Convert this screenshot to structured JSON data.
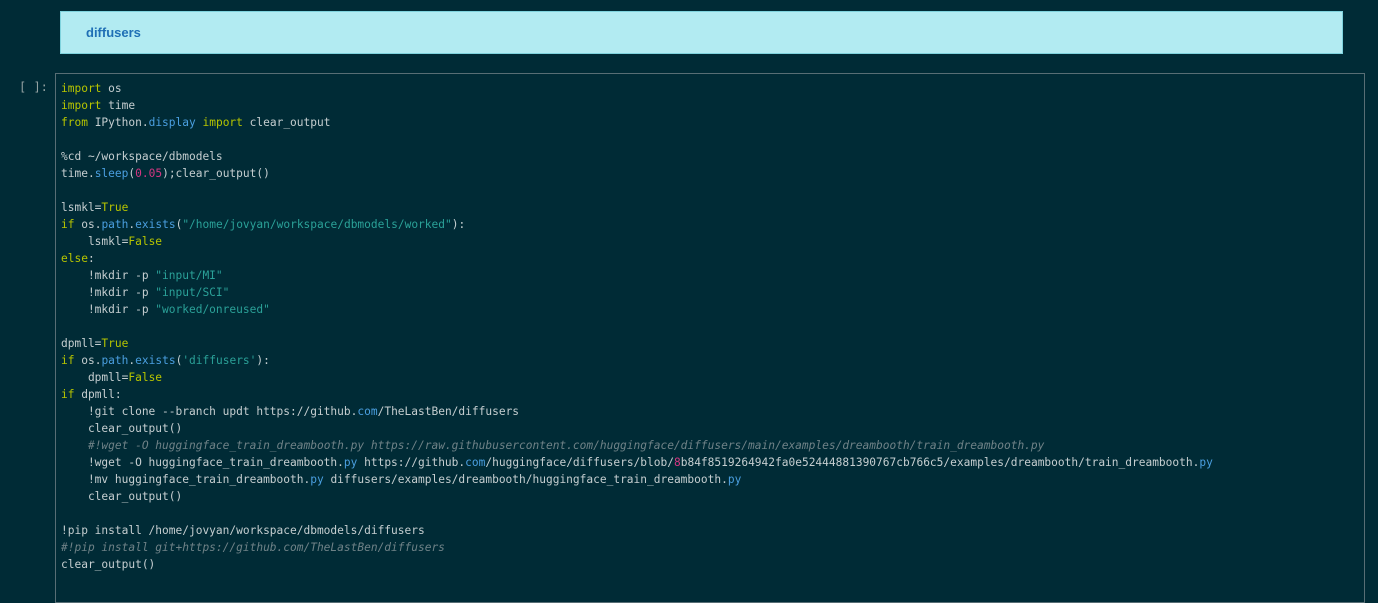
{
  "banner": {
    "title": "diffusers"
  },
  "cell": {
    "prompt": "[ ]:",
    "lines": [
      [
        [
          "kw",
          "import"
        ],
        [
          "plain",
          " os"
        ]
      ],
      [
        [
          "kw",
          "import"
        ],
        [
          "plain",
          " time"
        ]
      ],
      [
        [
          "kw",
          "from"
        ],
        [
          "plain",
          " IPython."
        ],
        [
          "attr",
          "display"
        ],
        [
          "plain",
          " "
        ],
        [
          "kw",
          "import"
        ],
        [
          "plain",
          " clear_output"
        ]
      ],
      [],
      [
        [
          "plain",
          "%cd ~/workspace/dbmodels"
        ]
      ],
      [
        [
          "plain",
          "time."
        ],
        [
          "attr",
          "sleep"
        ],
        [
          "plain",
          "("
        ],
        [
          "num",
          "0.05"
        ],
        [
          "plain",
          ");clear_output()"
        ]
      ],
      [],
      [
        [
          "plain",
          "lsmkl="
        ],
        [
          "kw",
          "True"
        ]
      ],
      [
        [
          "kw",
          "if"
        ],
        [
          "plain",
          " os."
        ],
        [
          "attr",
          "path"
        ],
        [
          "plain",
          "."
        ],
        [
          "attr",
          "exists"
        ],
        [
          "plain",
          "("
        ],
        [
          "str",
          "\"/home/jovyan/workspace/dbmodels/worked\""
        ],
        [
          "plain",
          "):"
        ]
      ],
      [
        [
          "plain",
          "    lsmkl="
        ],
        [
          "kw",
          "False"
        ]
      ],
      [
        [
          "kw",
          "else"
        ],
        [
          "plain",
          ":"
        ]
      ],
      [
        [
          "plain",
          "    !mkdir -p "
        ],
        [
          "str",
          "\"input/MI\""
        ]
      ],
      [
        [
          "plain",
          "    !mkdir -p "
        ],
        [
          "str",
          "\"input/SCI\""
        ]
      ],
      [
        [
          "plain",
          "    !mkdir -p "
        ],
        [
          "str",
          "\"worked/onreused\""
        ]
      ],
      [],
      [
        [
          "plain",
          "dpmll="
        ],
        [
          "kw",
          "True"
        ]
      ],
      [
        [
          "kw",
          "if"
        ],
        [
          "plain",
          " os."
        ],
        [
          "attr",
          "path"
        ],
        [
          "plain",
          "."
        ],
        [
          "attr",
          "exists"
        ],
        [
          "plain",
          "("
        ],
        [
          "str",
          "'diffusers'"
        ],
        [
          "plain",
          "):"
        ]
      ],
      [
        [
          "plain",
          "    dpmll="
        ],
        [
          "kw",
          "False"
        ]
      ],
      [
        [
          "kw",
          "if"
        ],
        [
          "plain",
          " dpmll:"
        ]
      ],
      [
        [
          "plain",
          "    !git clone --branch updt https://github."
        ],
        [
          "attr",
          "com"
        ],
        [
          "plain",
          "/TheLastBen/diffusers"
        ]
      ],
      [
        [
          "plain",
          "    clear_output()"
        ]
      ],
      [
        [
          "plain",
          "    "
        ],
        [
          "cmt",
          "#!wget -O huggingface_train_dreambooth.py https://raw.githubusercontent.com/huggingface/diffusers/main/examples/dreambooth/train_dreambooth.py"
        ]
      ],
      [
        [
          "plain",
          "    !wget -O huggingface_train_dreambooth."
        ],
        [
          "attr",
          "py"
        ],
        [
          "plain",
          " https://github."
        ],
        [
          "attr",
          "com"
        ],
        [
          "plain",
          "/huggingface/diffusers/blob/"
        ],
        [
          "num",
          "8"
        ],
        [
          "plain",
          "b84f8519264942fa0e52444881390767cb766c5/examples/dreambooth/train_dreambooth."
        ],
        [
          "attr",
          "py"
        ]
      ],
      [
        [
          "plain",
          "    !mv huggingface_train_dreambooth."
        ],
        [
          "attr",
          "py"
        ],
        [
          "plain",
          " diffusers/examples/dreambooth/huggingface_train_dreambooth."
        ],
        [
          "attr",
          "py"
        ]
      ],
      [
        [
          "plain",
          "    clear_output()"
        ]
      ],
      [],
      [
        [
          "plain",
          "!pip install /home/jovyan/workspace/dbmodels/diffusers"
        ]
      ],
      [
        [
          "cmt",
          "#!pip install git+https://github.com/TheLastBen/diffusers"
        ]
      ],
      [
        [
          "plain",
          "clear_output()"
        ]
      ]
    ]
  }
}
